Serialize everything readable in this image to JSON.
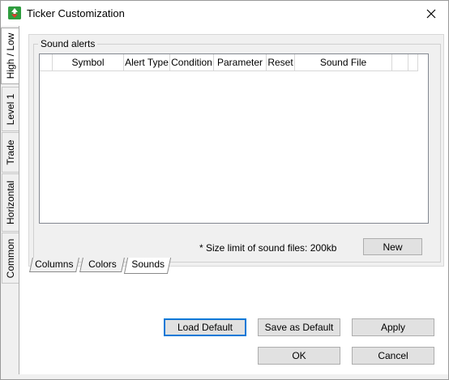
{
  "window": {
    "title": "Ticker Customization",
    "close_glyph": "close-icon"
  },
  "vertical_tabs": [
    {
      "label": "High / Low",
      "active": true
    },
    {
      "label": "Level 1",
      "active": false
    },
    {
      "label": "Trade",
      "active": false
    },
    {
      "label": "Horizontal",
      "active": false
    },
    {
      "label": "Common",
      "active": false
    }
  ],
  "sound_alerts": {
    "group_label": "Sound alerts",
    "columns": [
      "",
      "Symbol",
      "Alert Type",
      "Condition",
      "Parameter",
      "Reset",
      "Sound File",
      "",
      ""
    ],
    "rows": [],
    "limit_text": "* Size limit of sound files: 200kb",
    "new_button": "New"
  },
  "bottom_tabs": [
    {
      "label": "Columns",
      "active": false
    },
    {
      "label": "Colors",
      "active": false
    },
    {
      "label": "Sounds",
      "active": true
    }
  ],
  "buttons": {
    "load_default": "Load Default",
    "save_as_default": "Save as Default",
    "apply": "Apply",
    "ok": "OK",
    "cancel": "Cancel"
  },
  "colors": {
    "app_icon": "#2f9d3f",
    "default_button_border": "#0078d7"
  }
}
